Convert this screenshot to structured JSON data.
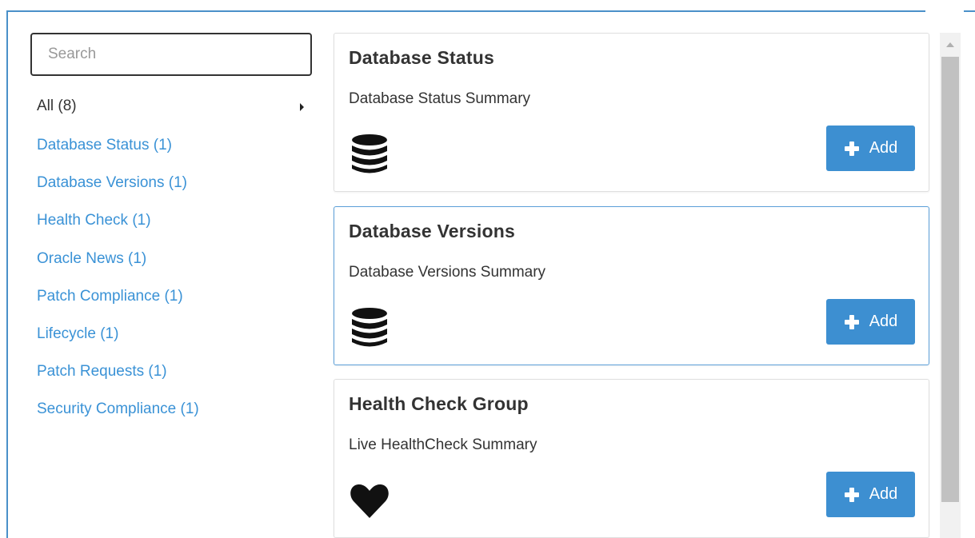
{
  "search": {
    "placeholder": "Search",
    "value": ""
  },
  "categories": {
    "all_label": "All (8)",
    "items": [
      {
        "label": "Database Status (1)"
      },
      {
        "label": "Database Versions (1)"
      },
      {
        "label": "Health Check (1)"
      },
      {
        "label": "Oracle News (1)"
      },
      {
        "label": "Patch Compliance (1)"
      },
      {
        "label": "Lifecycle (1)"
      },
      {
        "label": "Patch Requests (1)"
      },
      {
        "label": "Security Compliance (1)"
      }
    ]
  },
  "cards": [
    {
      "title": "Database Status",
      "summary": "Database Status Summary",
      "icon": "database-icon",
      "button_label": "Add"
    },
    {
      "title": "Database Versions",
      "summary": "Database Versions Summary",
      "icon": "database-icon",
      "button_label": "Add",
      "selected": true
    },
    {
      "title": "Health Check Group",
      "summary": "Live HealthCheck Summary",
      "icon": "heart-icon",
      "button_label": "Add"
    }
  ],
  "colors": {
    "accent": "#3d8fd1",
    "link": "#3a92d6",
    "frame_border": "#4a90c9",
    "selected_border": "#5b9fd8"
  }
}
